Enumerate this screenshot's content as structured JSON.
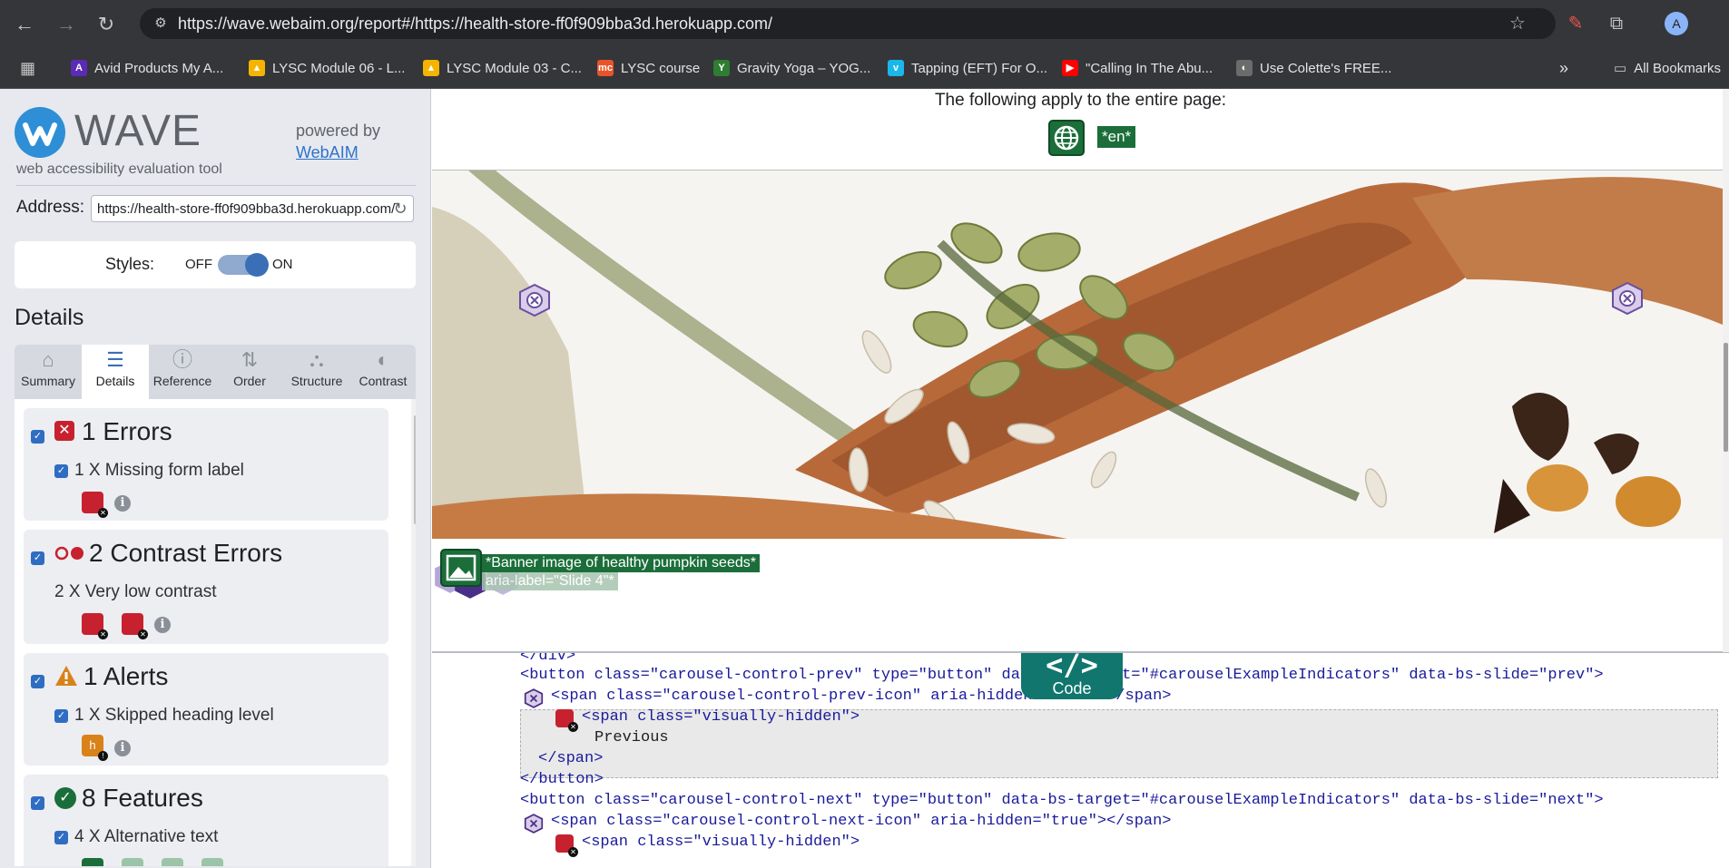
{
  "browser": {
    "url": "https://wave.webaim.org/report#/https://health-store-ff0f909bba3d.herokuapp.com/",
    "profile_initial": "A",
    "bookmarks": [
      {
        "label": "Avid Products My A...",
        "icon": "avid-icon",
        "color": "#5b2bb5"
      },
      {
        "label": "LYSC Module 06 - L...",
        "icon": "google-drive-icon",
        "color": "#f4b400"
      },
      {
        "label": "LYSC Module 03 - C...",
        "icon": "google-drive-icon",
        "color": "#f4b400"
      },
      {
        "label": "LYSC course",
        "icon": "mc-icon",
        "color": "#e8542a",
        "glyph": "mc"
      },
      {
        "label": "Gravity Yoga – YOG...",
        "icon": "yoga-icon",
        "color": "#2e7d32",
        "glyph": "Y"
      },
      {
        "label": "Tapping (EFT) For O...",
        "icon": "vimeo-icon",
        "color": "#1ab7ea",
        "glyph": "v"
      },
      {
        "label": "\"Calling In The Abu...",
        "icon": "youtube-icon",
        "color": "#ff0000",
        "glyph": "▶"
      },
      {
        "label": "Use Colette's FREE...",
        "icon": "site-icon",
        "color": "#6b6b6b",
        "glyph": "◐"
      }
    ],
    "all_bookmarks": "All Bookmarks"
  },
  "sidebar": {
    "logo_word": "WAVE",
    "logo_sub": "web accessibility evaluation tool",
    "powered_by": "powered by",
    "webaim_link": "WebAIM",
    "address_label": "Address:",
    "address_value": "https://health-store-ff0f909bba3d.herokuapp.com/",
    "styles_label": "Styles:",
    "styles_off": "OFF",
    "styles_on": "ON",
    "details_heading": "Details",
    "tabs": [
      {
        "label": "Summary",
        "icon": "home-icon",
        "glyph": "⌂"
      },
      {
        "label": "Details",
        "icon": "list-icon",
        "glyph": "☰"
      },
      {
        "label": "Reference",
        "icon": "info-icon",
        "glyph": "ⓘ"
      },
      {
        "label": "Order",
        "icon": "order-icon",
        "glyph": "⇅"
      },
      {
        "label": "Structure",
        "icon": "structure-icon",
        "glyph": "⛬"
      },
      {
        "label": "Contrast",
        "icon": "contrast-icon",
        "glyph": "◐"
      }
    ],
    "active_tab": "Details",
    "categories": {
      "errors": {
        "title": "1 Errors",
        "item": "1 X Missing form label"
      },
      "contrast": {
        "title": "2 Contrast Errors",
        "item": "2 X Very low contrast"
      },
      "alerts": {
        "title": "1 Alerts",
        "item": "1 X Skipped heading level"
      },
      "features": {
        "title": "8 Features",
        "item": "4 X Alternative text"
      }
    },
    "colors": {
      "error": "#c7212f",
      "alert": "#d9821a",
      "feature": "#1b6e3a"
    }
  },
  "main": {
    "apply_text": "The following apply to the entire page:",
    "lang_badge": "*en*",
    "alt_text": "*Banner image of healthy pumpkin seeds*",
    "aria_label": "aria-label=\"Slide 4\"*",
    "code_toggle": "Code",
    "code_glyph": "</>",
    "code_lines": [
      "</div>",
      "<button class=\"carousel-control-prev\" type=\"button\" data-bs-target=\"#carouselExampleIndicators\" data-bs-slide=\"prev\">",
      "<span class=\"carousel-control-prev-icon\" aria-hidden=\"true\"></span>",
      "<span class=\"visually-hidden\">",
      "Previous",
      "</span>",
      "</button>",
      "<button class=\"carousel-control-next\" type=\"button\" data-bs-target=\"#carouselExampleIndicators\" data-bs-slide=\"next\">",
      "<span class=\"carousel-control-next-icon\" aria-hidden=\"true\"></span>",
      "<span class=\"visually-hidden\">"
    ]
  }
}
